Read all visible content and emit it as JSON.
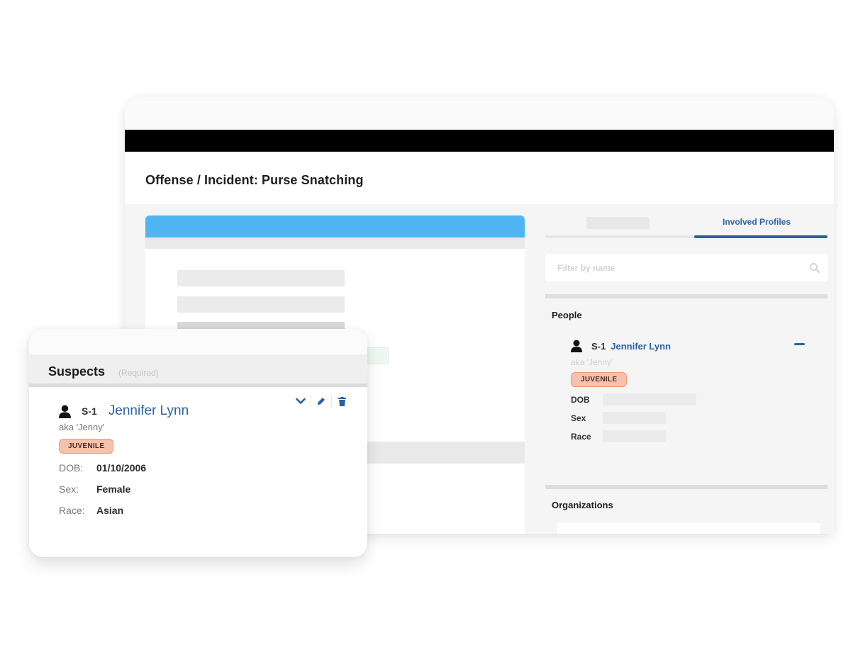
{
  "page": {
    "title": "Offense / Incident: Purse Snatching"
  },
  "colors": {
    "accent_blue": "#2a62a6",
    "form_header_blue": "#4fb6f3",
    "badge_bg": "#f8c1ae",
    "badge_border": "#ef9775"
  },
  "right_panel": {
    "tabs": [
      {
        "label": "",
        "active": false
      },
      {
        "label": "Involved Profiles",
        "active": true
      }
    ],
    "filter": {
      "placeholder": "Filter by name",
      "value": "",
      "icon": "search-icon"
    },
    "people_section": {
      "label": "People",
      "items": [
        {
          "icon": "person-icon",
          "id": "S-1",
          "name": "Jennifer Lynn",
          "aka": "aka 'Jenny'",
          "badge": "JUVENILE",
          "fields": [
            {
              "label": "DOB"
            },
            {
              "label": "Sex"
            },
            {
              "label": "Race"
            }
          ],
          "collapse_icon": "minus-icon"
        }
      ]
    },
    "organizations_section": {
      "label": "Organizations"
    }
  },
  "suspects_card": {
    "title": "Suspects",
    "required_label": "(Required)",
    "suspect": {
      "icon": "person-icon",
      "id": "S-1",
      "name": "Jennifer Lynn",
      "aka": "aka 'Jenny'",
      "badge": "JUVENILE",
      "actions": [
        "chevron-down-icon",
        "edit-icon",
        "trash-icon"
      ],
      "fields": [
        {
          "label": "DOB:",
          "value": "01/10/2006"
        },
        {
          "label": "Sex:",
          "value": "Female"
        },
        {
          "label": "Race:",
          "value": "Asian"
        }
      ]
    }
  }
}
